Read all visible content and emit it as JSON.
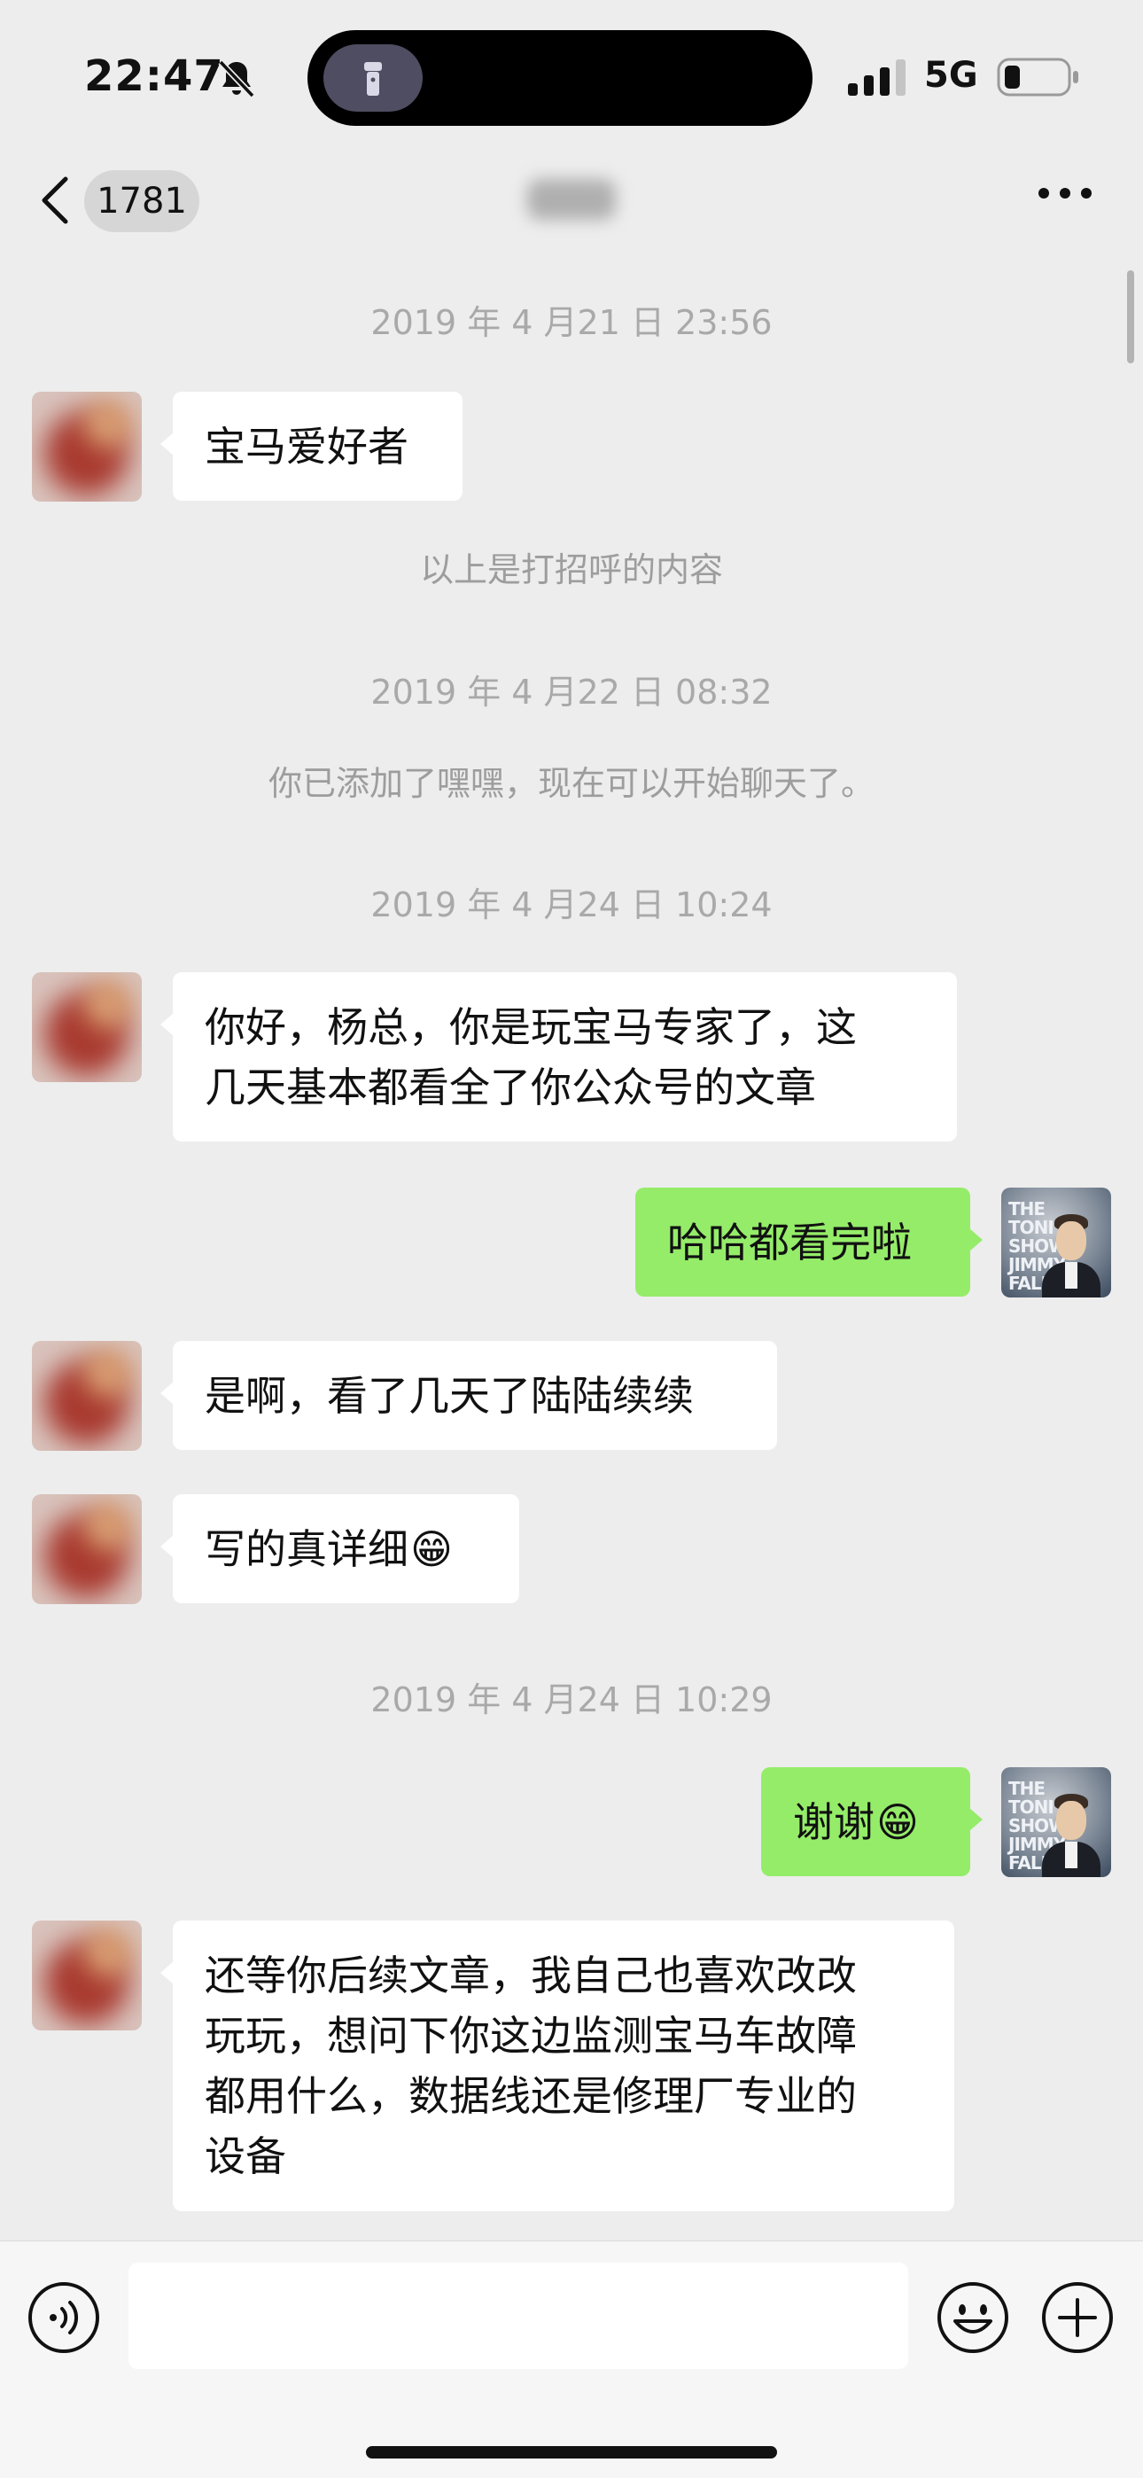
{
  "status_bar": {
    "time": "22:47",
    "network": "5G",
    "icons": [
      "bell-slash-icon",
      "flashlight-icon",
      "cellular-signal-icon",
      "battery-low-icon"
    ]
  },
  "nav": {
    "back_icon": "chevron-left-icon",
    "unread_count": "1781",
    "more_icon": "ellipsis-icon"
  },
  "messages": {
    "ts1": "2019 年 4 月21 日 23:56",
    "m1": "宝马爱好者",
    "sys1": "以上是打招呼的内容",
    "ts2": "2019 年 4 月22 日 08:32",
    "sys2": "你已添加了嘿嘿，现在可以开始聊天了。",
    "ts3": "2019 年 4 月24 日 10:24",
    "m2": "你好，杨总，你是玩宝马专家了，这\n几天基本都看全了你公众号的文章",
    "m3": "哈哈都看完啦",
    "m4": "是啊，看了几天了陆陆续续",
    "m5": "写的真详细",
    "m5_emoji": "😁",
    "ts4": "2019 年 4 月24 日 10:29",
    "m6": "谢谢",
    "m6_emoji": "😁",
    "m7": "还等你后续文章，我自己也喜欢改改\n玩玩，想问下你这边监测宝马车故障\n都用什么，数据线还是修理厂专业的\n设备",
    "self_avatar_text": "THE\nTONI\nSHOW\nJIMMY\nFALLON"
  },
  "input_bar": {
    "icons": [
      "voice-icon",
      "emoji-icon",
      "plus-icon"
    ]
  },
  "colors": {
    "background": "#ededed",
    "outgoing_bubble": "#95ec69",
    "incoming_bubble": "#ffffff"
  }
}
